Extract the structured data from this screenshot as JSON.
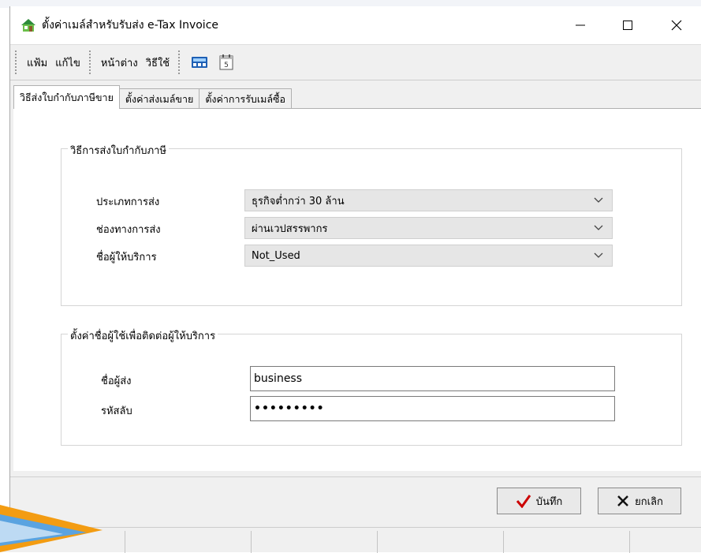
{
  "window": {
    "title": "ตั้งค่าเมล์สำหรับรับส่ง e-Tax Invoice"
  },
  "menu": {
    "items": [
      "แฟ้ม",
      "แก้ไข",
      "หน้าต่าง",
      "วิธีใช้"
    ]
  },
  "tabs": [
    {
      "label": "วิธีส่งใบกำกับภาษีขาย",
      "active": true
    },
    {
      "label": "ตั้งค่าส่งเมล์ขาย",
      "active": false
    },
    {
      "label": "ตั้งค่าการรับเมล์ซื้อ",
      "active": false
    }
  ],
  "send_method_group": {
    "title": "วิธีการส่งใบกำกับภาษี",
    "fields": [
      {
        "label": "ประเภทการส่ง",
        "value": "ธุรกิจต่ำกว่า 30 ล้าน"
      },
      {
        "label": "ช่องทางการส่ง",
        "value": "ผ่านเวปสรรพากร"
      },
      {
        "label": "ชื่อผู้ให้บริการ",
        "value": "Not_Used"
      }
    ]
  },
  "provider_group": {
    "title": "ตั้งค่าชื่อผู้ใช้เพื่อติดต่อผู้ให้บริการ",
    "sender_label": "ชื่อผู้ส่ง",
    "sender_value": "business",
    "password_label": "รหัสลับ",
    "password_value": "•••••••••"
  },
  "buttons": {
    "save": "บันทึก",
    "cancel": "ยกเลิก"
  },
  "colors": {
    "accent_check": "#cc0000",
    "decor_orange": "#f39c12",
    "decor_blue": "#5aa3e0"
  }
}
